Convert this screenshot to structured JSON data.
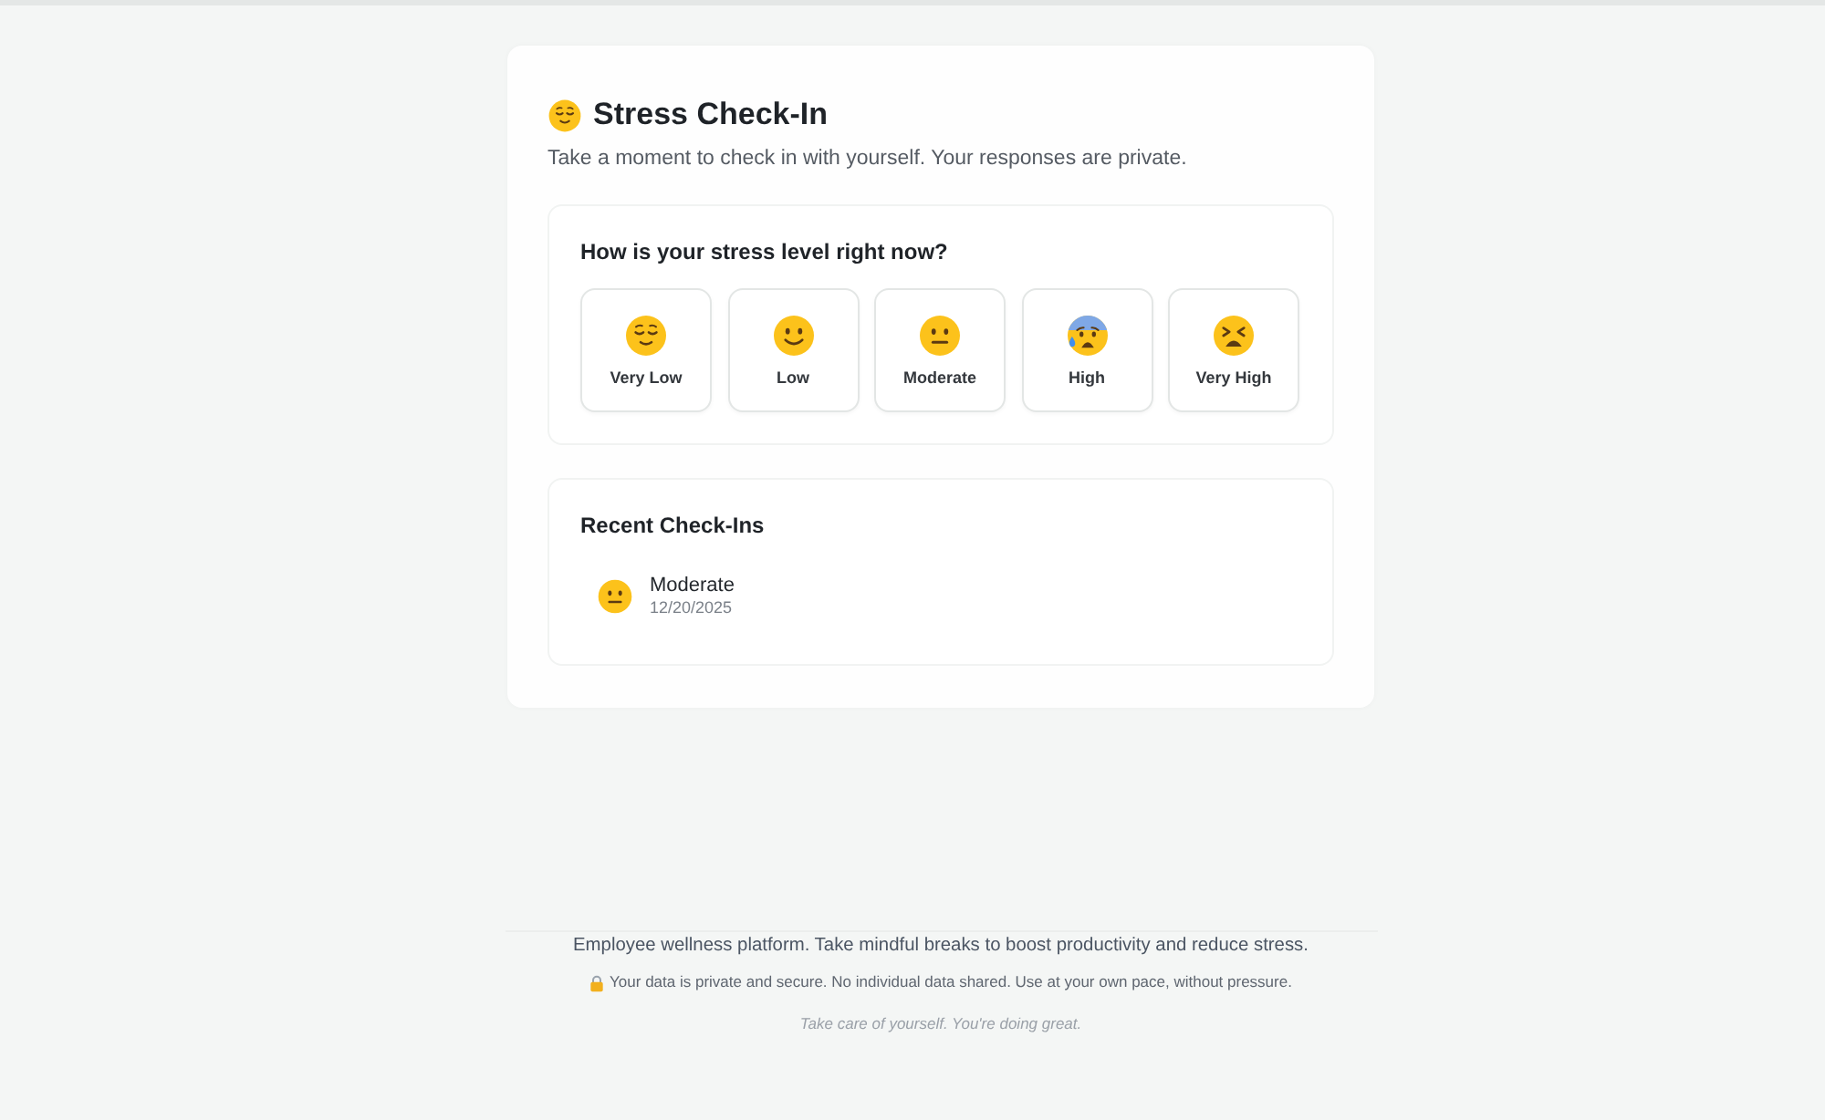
{
  "header": {
    "title": "Stress Check-In",
    "subtitle": "Take a moment to check in with yourself. Your responses are private."
  },
  "stress_question": {
    "title": "How is your stress level right now?",
    "options": [
      {
        "label": "Very Low",
        "kind": "relieved",
        "selected": false
      },
      {
        "label": "Low",
        "kind": "smile",
        "selected": false
      },
      {
        "label": "Moderate",
        "kind": "neutral",
        "selected": false
      },
      {
        "label": "High",
        "kind": "anxious",
        "selected": false
      },
      {
        "label": "Very High",
        "kind": "tired",
        "selected": false
      }
    ]
  },
  "recent_checkins": {
    "title": "Recent Check-Ins",
    "items": [
      {
        "kind": "neutral",
        "label": "Moderate",
        "date": "12/20/2025"
      }
    ]
  },
  "footer": {
    "tagline": "Employee wellness platform. Take mindful breaks to boost productivity and reduce stress.",
    "privacy_note": "Your data is private and secure. No individual data shared. Use at your own pace, without pressure.",
    "encouragement": "Take care of yourself. You're doing great."
  }
}
